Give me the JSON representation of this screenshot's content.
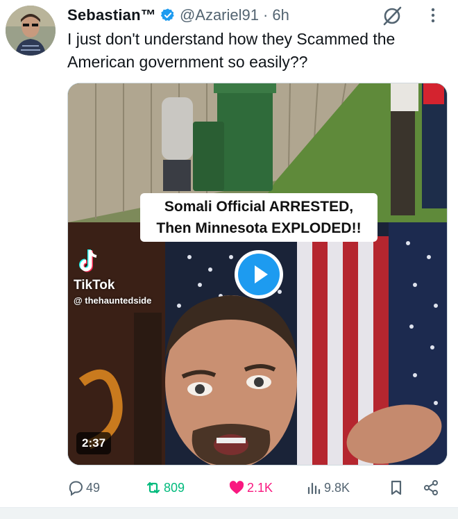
{
  "post": {
    "author_name": "SebastianᵀᴹTM",
    "display_name": "Sebastian™",
    "handle": "@Azariel91",
    "separator": "·",
    "time": "6h",
    "text": "I just don't understand how they Scammed the American government so easily??"
  },
  "media": {
    "caption_line1": "Somali Official ARRESTED,",
    "caption_line2": "Then Minnesota EXPLODED!!",
    "watermark_brand": "TikTok",
    "watermark_user": "@ thehauntedside",
    "duration": "2:37",
    "play_icon": "play-icon"
  },
  "actions": {
    "replies": "49",
    "reposts": "809",
    "likes": "2.1K",
    "views": "9.8K"
  },
  "colors": {
    "verified": "#1d9bf0",
    "like": "#f91880",
    "repost": "#00ba7c",
    "secondary_text": "#536471"
  }
}
